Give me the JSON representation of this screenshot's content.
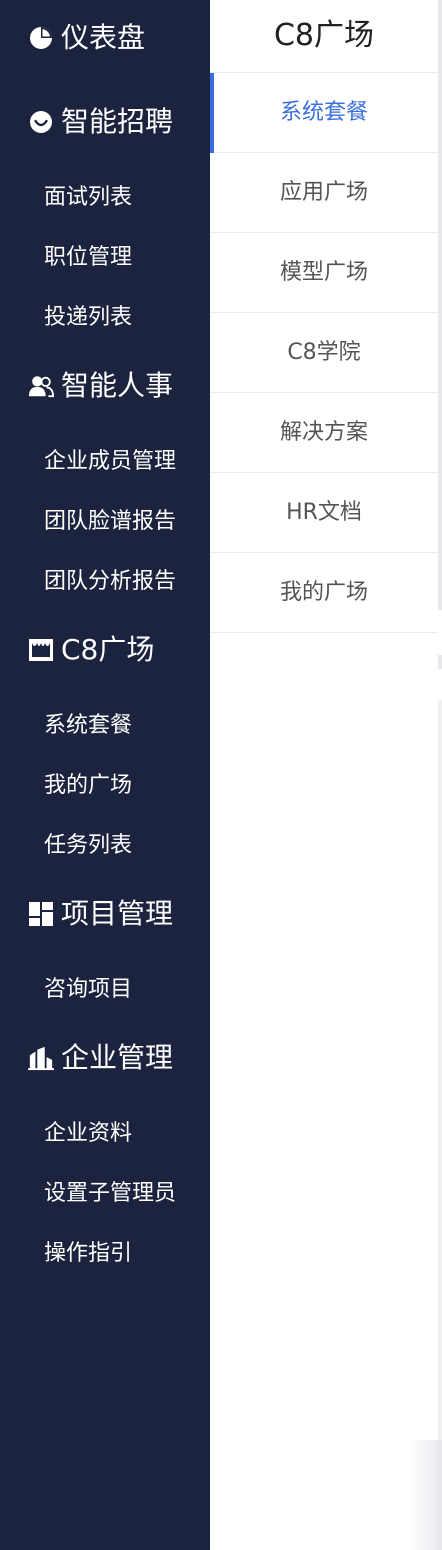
{
  "sidebar": {
    "sections": [
      {
        "label": "仪表盘",
        "icon": "pie-chart-icon",
        "items": []
      },
      {
        "label": "智能招聘",
        "icon": "smile-icon",
        "items": [
          "面试列表",
          "职位管理",
          "投递列表"
        ]
      },
      {
        "label": "智能人事",
        "icon": "users-icon",
        "items": [
          "企业成员管理",
          "团队脸谱报告",
          "团队分析报告"
        ]
      },
      {
        "label": "C8广场",
        "icon": "store-icon",
        "items": [
          "系统套餐",
          "我的广场",
          "任务列表"
        ]
      },
      {
        "label": "项目管理",
        "icon": "grid-icon",
        "items": [
          "咨询项目"
        ]
      },
      {
        "label": "企业管理",
        "icon": "building-icon",
        "items": [
          "企业资料",
          "设置子管理员",
          "操作指引"
        ]
      }
    ]
  },
  "panel": {
    "title": "C8广场",
    "items": [
      "系统套餐",
      "应用广场",
      "模型广场",
      "C8学院",
      "解决方案",
      "HR文档",
      "我的广场"
    ],
    "active_index": 0
  },
  "colors": {
    "sidebar_bg": "#1b233e",
    "accent": "#3b6fe0"
  }
}
